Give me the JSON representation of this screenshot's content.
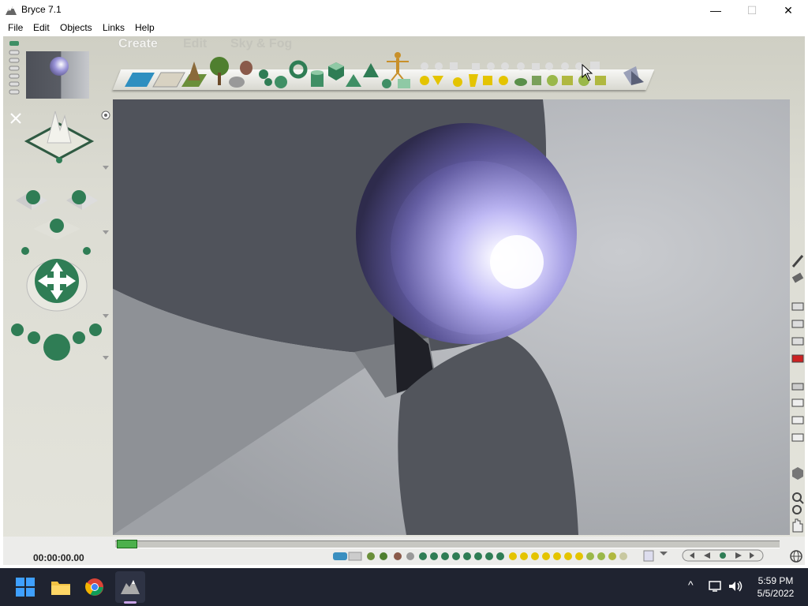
{
  "window": {
    "title": "Bryce 7.1",
    "minimize_glyph": "—",
    "maximize_glyph": "☐",
    "close_glyph": "✕"
  },
  "menu": {
    "items": [
      {
        "label": "File"
      },
      {
        "label": "Edit"
      },
      {
        "label": "Objects"
      },
      {
        "label": "Links"
      },
      {
        "label": "Help"
      }
    ]
  },
  "tabs": {
    "create": "Create",
    "edit": "Edit",
    "sky_fog": "Sky & Fog"
  },
  "timeline": {
    "time_code": "00:00:00.00"
  },
  "taskbar": {
    "time": "5:59 PM",
    "date": "5/5/2022",
    "tray_chevron": "^"
  },
  "colors": {
    "sphere": "#9a94d8",
    "viewport_bg": "#b0b2b6",
    "palette_green": "#2f7d55",
    "taskbar_bg": "#1f2330",
    "primitive_yellow": "#e4c400"
  },
  "icons": {
    "app": "bryce-mountain-icon",
    "start": "windows-start-icon",
    "explorer": "file-explorer-icon",
    "browser": "chrome-icon",
    "bryce_task": "bryce-taskbar-icon"
  }
}
